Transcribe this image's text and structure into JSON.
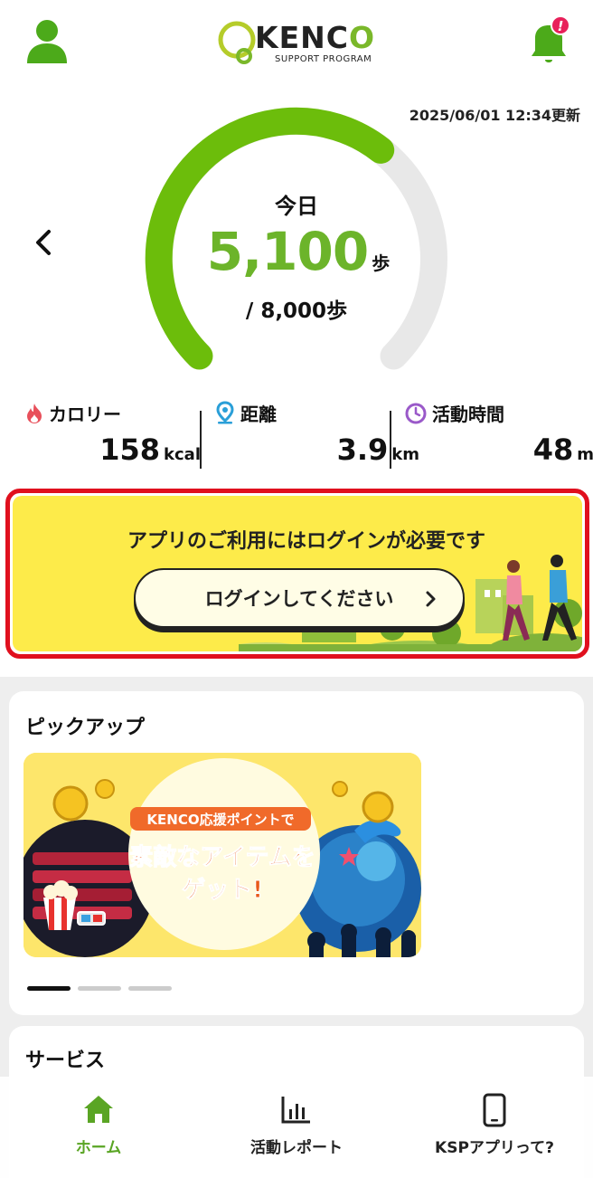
{
  "header": {
    "logo_name": "KENC",
    "logo_o": "O",
    "logo_sub": "SUPPORT PROGRAM",
    "user_icon": "user-icon",
    "bell_icon": "bell-icon",
    "bell_badge": "!"
  },
  "steps": {
    "updated": "2025/06/01 12:34更新",
    "today_label": "今日",
    "value": "5,100",
    "unit": "歩",
    "goal": "/ 8,000歩",
    "progress_fraction": 0.64
  },
  "metrics": [
    {
      "label": "カロリー",
      "value": "158",
      "unit": "kcal",
      "icon": "flame-icon",
      "color": "#e8505b"
    },
    {
      "label": "距離",
      "value": "3.9",
      "unit": "km",
      "icon": "map-pin-icon",
      "color": "#2a9fd8"
    },
    {
      "label": "活動時間",
      "value": "48",
      "unit": "min",
      "icon": "clock-icon",
      "color": "#9a59c9"
    }
  ],
  "login_banner": {
    "message": "アプリのご利用にはログインが必要です",
    "button_label": "ログインしてください"
  },
  "pickup": {
    "title": "ピックアップ",
    "banner_line1": "KENCO応援ポイントで",
    "banner_line2": "素敵なアイテムを",
    "banner_line3": "ゲット!",
    "slides_count": 3,
    "active_slide": 1
  },
  "service": {
    "title": "サービス"
  },
  "tabbar": [
    {
      "label": "ホーム",
      "icon": "home-icon",
      "active": true
    },
    {
      "label": "活動レポート",
      "icon": "bar-chart-icon",
      "active": false
    },
    {
      "label": "KSPアプリって?",
      "icon": "smartphone-icon",
      "active": false
    }
  ],
  "colors": {
    "brand_green": "#6cb42a",
    "alert_red": "#e0101e",
    "banner_yellow": "#fdeb4a",
    "badge_pink": "#e8205a"
  }
}
